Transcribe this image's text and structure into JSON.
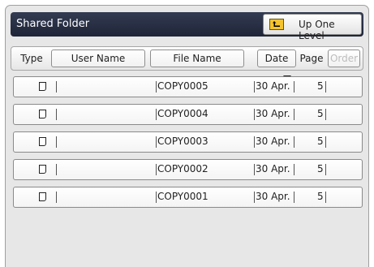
{
  "header": {
    "folder_title": "Shared Folder",
    "up_button_label": "Up One Level",
    "up_icon": "folder-up-icon"
  },
  "columns": [
    {
      "label": "Type",
      "enabled": true,
      "button": false
    },
    {
      "label": "User Name",
      "enabled": true,
      "button": true
    },
    {
      "label": "File Name",
      "enabled": true,
      "button": true
    },
    {
      "label": "Date",
      "enabled": true,
      "button": true,
      "sorted": true
    },
    {
      "label": "Page",
      "enabled": true,
      "button": false
    },
    {
      "label": "Order",
      "enabled": false,
      "button": true
    }
  ],
  "files": [
    {
      "type_icon": "document-icon",
      "user": "",
      "name": "COPY0005",
      "date": "30 Apr.",
      "pages": "5"
    },
    {
      "type_icon": "document-icon",
      "user": "",
      "name": "COPY0004",
      "date": "30 Apr.",
      "pages": "5"
    },
    {
      "type_icon": "document-icon",
      "user": "",
      "name": "COPY0003",
      "date": "30 Apr.",
      "pages": "5"
    },
    {
      "type_icon": "document-icon",
      "user": "",
      "name": "COPY0002",
      "date": "30 Apr.",
      "pages": "5"
    },
    {
      "type_icon": "document-icon",
      "user": "",
      "name": "COPY0001",
      "date": "30 Apr.",
      "pages": "5"
    }
  ],
  "colors": {
    "title_bar": "#262d42",
    "panel_bg": "#e7e7e7",
    "folder_icon": "#f4c430"
  }
}
